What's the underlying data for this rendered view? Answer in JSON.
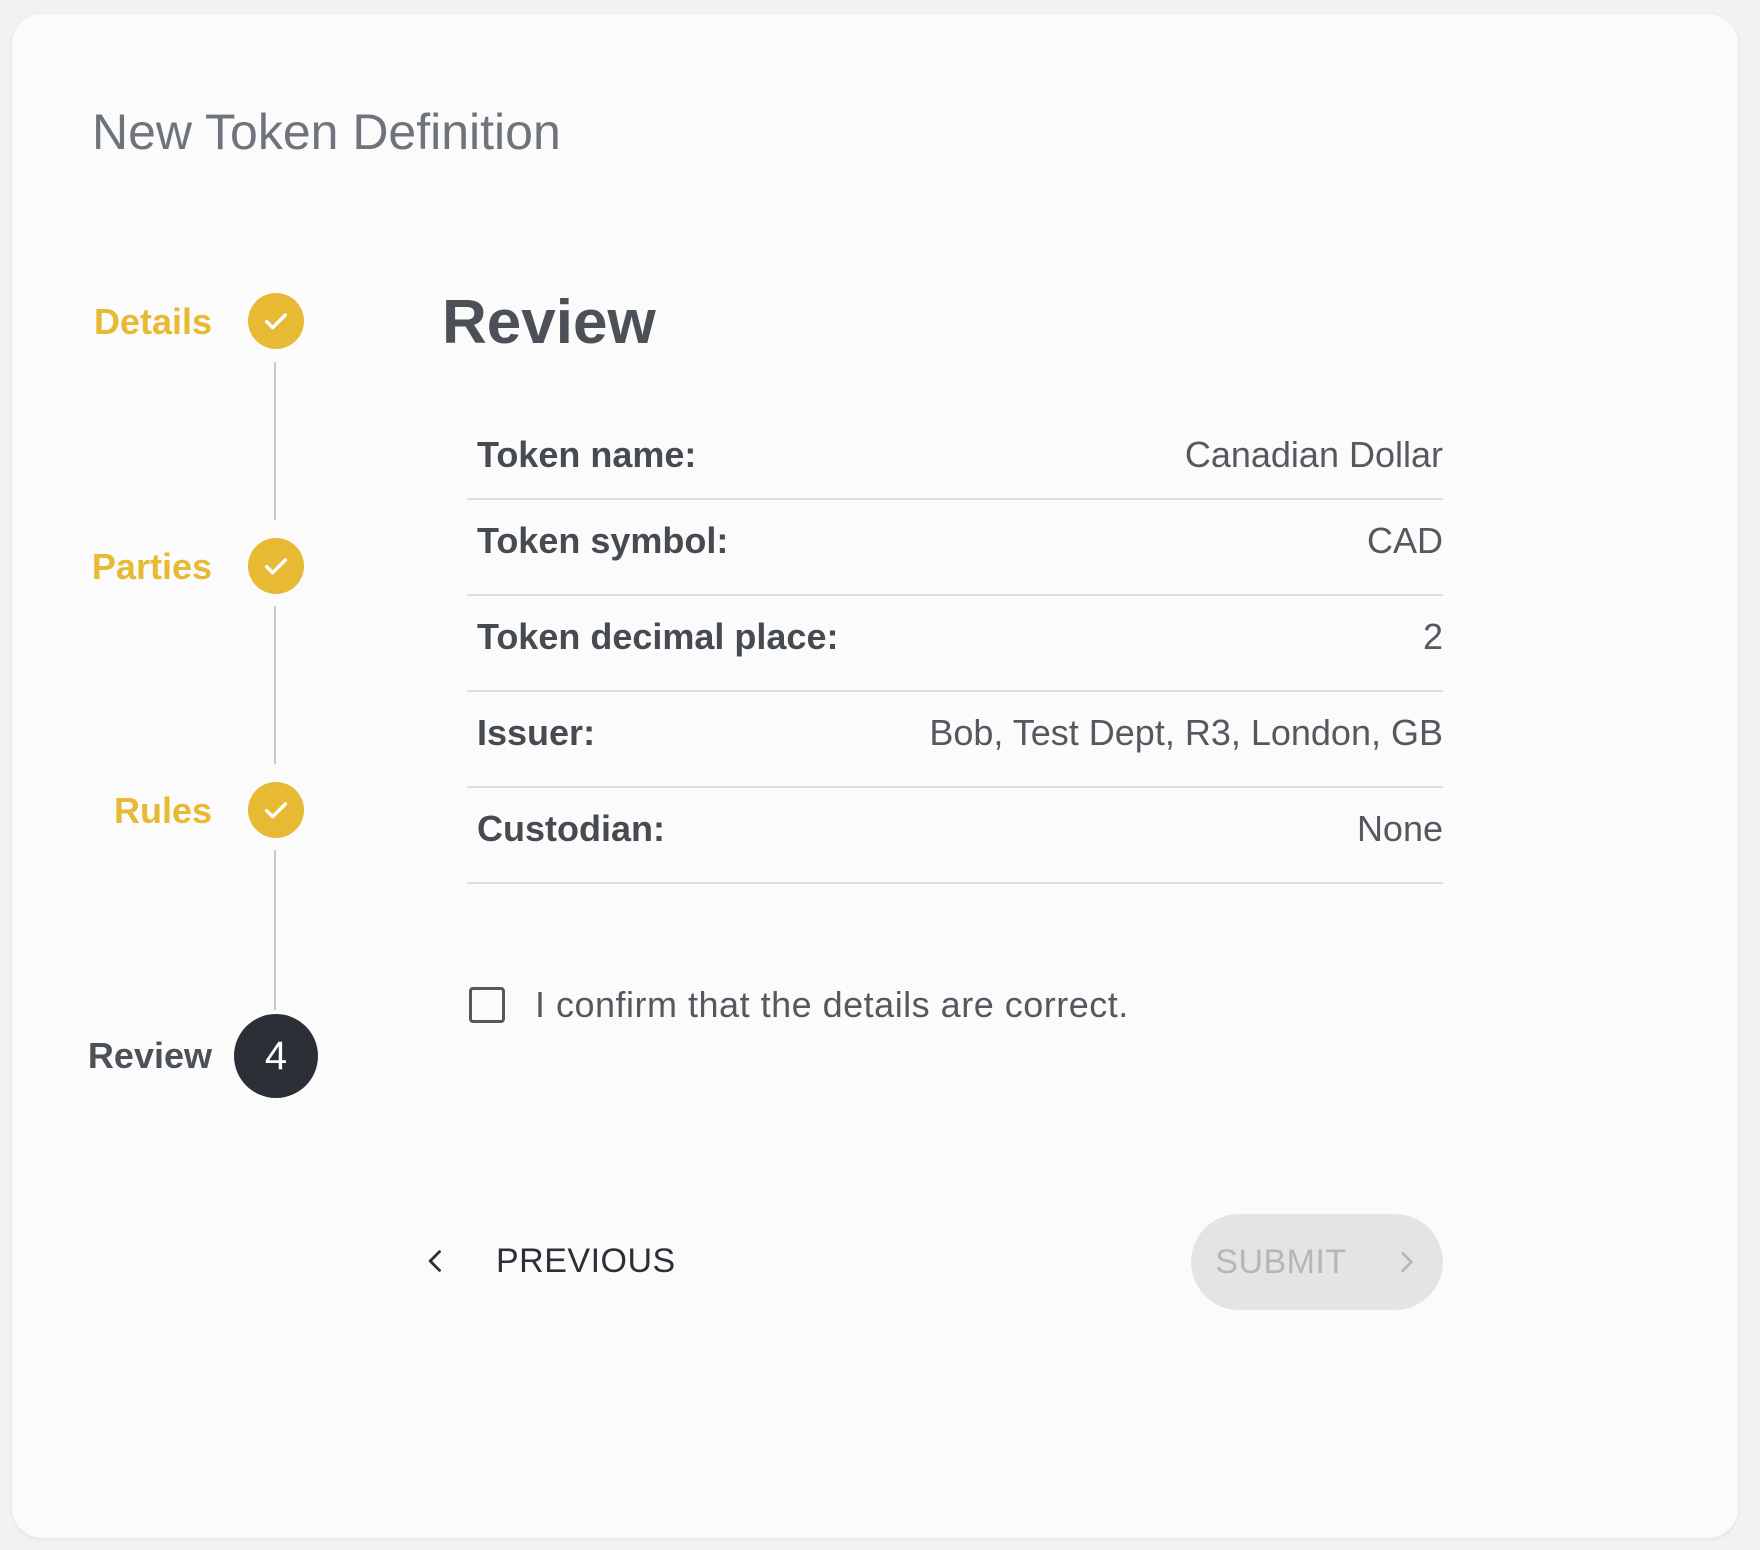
{
  "page": {
    "title": "New Token Definition"
  },
  "stepper": {
    "steps": [
      {
        "label": "Details",
        "status": "complete",
        "icon": "check-icon"
      },
      {
        "label": "Parties",
        "status": "complete",
        "icon": "check-icon"
      },
      {
        "label": "Rules",
        "status": "complete",
        "icon": "check-icon"
      },
      {
        "label": "Review",
        "status": "active",
        "number": "4"
      }
    ],
    "colors": {
      "complete": "#e8b932",
      "active": "#2b2f36",
      "active_label": "#4c5158"
    }
  },
  "review": {
    "title": "Review",
    "rows": [
      {
        "label": "Token name:",
        "value": "Canadian Dollar"
      },
      {
        "label": "Token symbol:",
        "value": "CAD"
      },
      {
        "label": "Token decimal place:",
        "value": "2"
      },
      {
        "label": "Issuer:",
        "value": "Bob, Test Dept, R3, London, GB"
      },
      {
        "label": "Custodian:",
        "value": "None"
      }
    ],
    "confirm_label": "I confirm that the details are correct.",
    "confirm_checked": false
  },
  "actions": {
    "previous_label": "PREVIOUS",
    "submit_label": "SUBMIT",
    "submit_disabled": true
  }
}
